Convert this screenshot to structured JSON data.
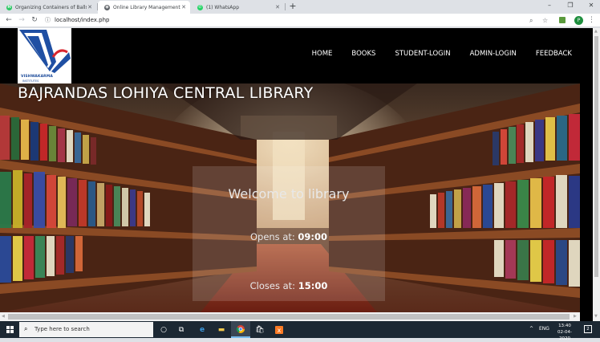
{
  "browser": {
    "tabs": [
      {
        "title": "Organizing Containers of Balls | ",
        "favicon": "hackerrank-icon",
        "color": "#2ec866"
      },
      {
        "title": "Online Library Management Syste",
        "favicon": "globe-icon",
        "color": "#5f6368"
      },
      {
        "title": "(1) WhatsApp",
        "favicon": "whatsapp-icon",
        "color": "#25d366"
      }
    ],
    "new_tab": "+",
    "url": "localhost/index.php",
    "profile_initial": "P"
  },
  "site": {
    "logo_text": "VISHWAKARMA",
    "logo_subtext": "INSTITUTES",
    "nav": [
      "HOME",
      "BOOKS",
      "STUDENT-LOGIN",
      "ADMIN-LOGIN",
      "FEEDBACK"
    ],
    "hero_title": "BAJRANDAS LOHIYA CENTRAL LIBRARY",
    "welcome": "Welcome to library",
    "opens_label": "Opens at:",
    "opens_time": "09:00",
    "closes_label": "Closes at:",
    "closes_time": "15:00"
  },
  "taskbar": {
    "search_placeholder": "Type here to search",
    "language": "ENG",
    "time": "13:40",
    "date": "02-04-2020",
    "notifications": "2"
  }
}
